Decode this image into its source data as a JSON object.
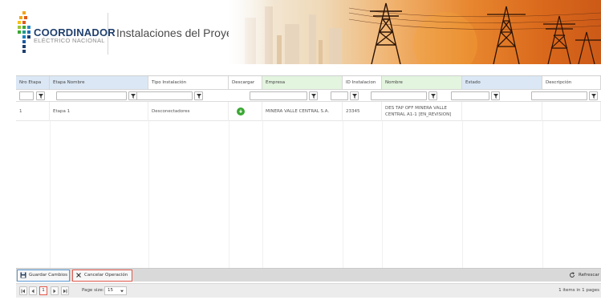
{
  "header": {
    "logo_title": "COORDINADOR",
    "logo_subtitle": "ELÉCTRICO NACIONAL",
    "page_title": "Instalaciones del Proyecto"
  },
  "grid": {
    "columns": [
      "Nro Etapa",
      "Etapa Nombre",
      "Tipo Instalación",
      "Descargar",
      "Empresa",
      "ID Instalacion",
      "Nombre",
      "Estado",
      "Descripción"
    ],
    "rows": [
      {
        "nro_etapa": "1",
        "etapa_nombre": "Etapa 1",
        "tipo_instalacion": "Desconectadores",
        "empresa": "MINERA VALLE CENTRAL S.A.",
        "id_instalacion": "23345",
        "nombre": "DES TAP OFF MINERA VALLE CENTRAL A1-1 [EN_REVISION]",
        "estado": "",
        "descripcion": ""
      }
    ]
  },
  "toolbar": {
    "save_label": "Guardar Cambios",
    "cancel_label": "Cancelar Operación",
    "refresh_label": "Refrescar"
  },
  "pager": {
    "current_page": "1",
    "page_size_label": "Page size:",
    "page_size_value": "15",
    "items_info": "1 items in 1 pages"
  },
  "colors": {
    "header_blue": "#dbe7f5",
    "header_green": "#e3f4df",
    "download_green": "#3aa832",
    "save_border": "#5b9bd5",
    "cancel_border": "#e05a4e",
    "logo_navy": "#1f3f6e"
  },
  "icons": {
    "filter": "filter-icon",
    "download": "download-icon",
    "save": "save-icon",
    "cancel": "close-icon",
    "refresh": "refresh-icon"
  }
}
